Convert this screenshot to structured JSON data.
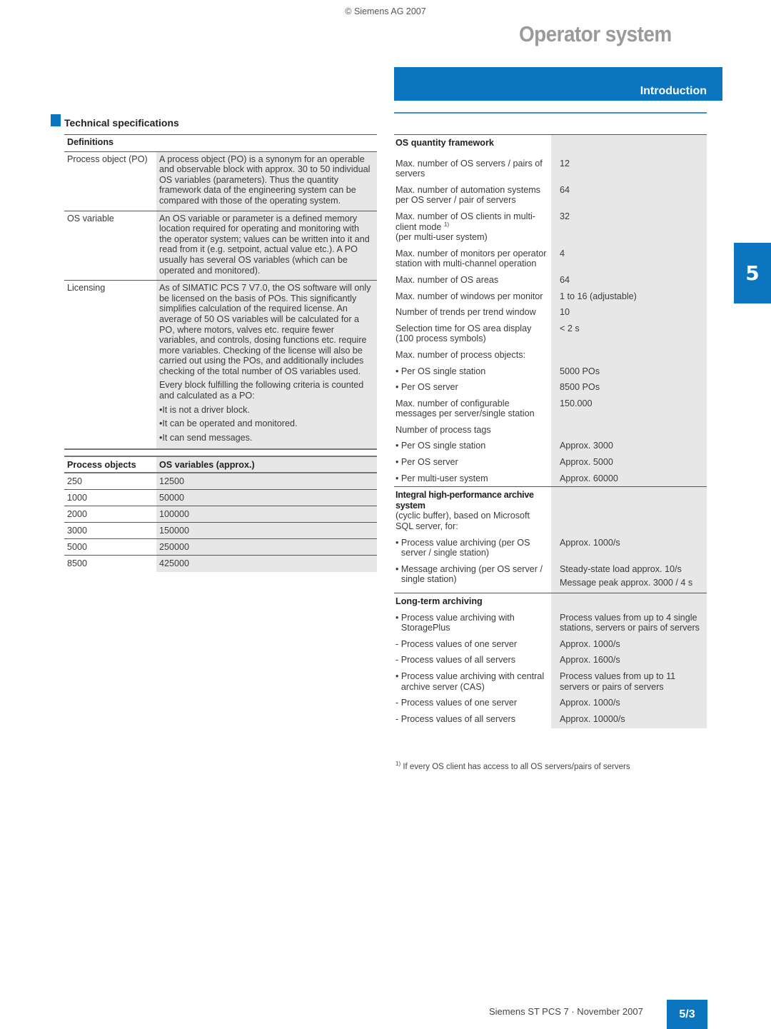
{
  "header": {
    "copyright": "© Siemens AG 2007",
    "page_title": "Operator system",
    "section": "Introduction",
    "chapter_tab": "5"
  },
  "spec_heading": "Technical specifications",
  "definitions": {
    "heading": "Definitions",
    "items": [
      {
        "term": "Process object (PO)",
        "paragraphs": [
          "A process object (PO) is a synonym for an operable and observable block with approx. 30 to 50 individual OS variables (parameters). Thus the quantity framework data of the engineering system can be compared with those of the operating system."
        ],
        "bullets": []
      },
      {
        "term": "OS variable",
        "paragraphs": [
          "An OS variable or parameter is a defined memory location required for operating and monitoring with the operator system; values can be written into it and read from it (e.g. setpoint, actual value etc.). A PO usually has several OS variables (which can be operated and monitored)."
        ],
        "bullets": []
      },
      {
        "term": "Licensing",
        "paragraphs": [
          "As of SIMATIC PCS 7 V7.0, the OS software will only be licensed on the basis of POs. This significantly simplifies calculation of the required license. An average of 50 OS variables will be calculated for a PO, where motors, valves etc. require fewer variables, and controls, dosing functions etc. require more variables. Checking of the license will also be carried out using the POs, and additionally includes checking of the total number of OS variables used.",
          "Every block fulfilling the following criteria is counted and calculated as a PO:"
        ],
        "bullets": [
          "It is not a driver block.",
          "It can be operated and monitored.",
          "It can send messages."
        ]
      }
    ]
  },
  "po_table": {
    "headers": [
      "Process objects",
      "OS variables (approx.)"
    ],
    "rows": [
      [
        "250",
        "12500"
      ],
      [
        "1000",
        "50000"
      ],
      [
        "2000",
        "100000"
      ],
      [
        "3000",
        "150000"
      ],
      [
        "5000",
        "250000"
      ],
      [
        "8500",
        "425000"
      ]
    ]
  },
  "quantity_framework": {
    "heading": "OS quantity framework",
    "rows": [
      {
        "label": "Max. number of OS servers / pairs of servers",
        "value": "12"
      },
      {
        "label": "Max. number of automation systems per OS server / pair of servers",
        "value": "64"
      },
      {
        "label": "Max. number of OS clients in multi-client mode",
        "footnote_ref": "1)",
        "label_suffix": "(per multi-user system)",
        "value": "32"
      },
      {
        "label": "Max. number of monitors per operator station with multi-channel operation",
        "value": "4"
      },
      {
        "label": "Max. number of OS areas",
        "value": "64"
      },
      {
        "label": "Max. number of windows per monitor",
        "value": "1 to 16 (adjustable)"
      },
      {
        "label": "Number of trends per trend window",
        "value": "10"
      },
      {
        "label": "Selection time for OS area display (100 process symbols)",
        "value": "< 2 s"
      },
      {
        "label": "Max. number of process objects:",
        "value": ""
      },
      {
        "label": "• Per OS single station",
        "value": "5000 POs"
      },
      {
        "label": "• Per OS server",
        "value": "8500 POs"
      },
      {
        "label": "Max. number of configurable messages per server/single station",
        "value": "150.000"
      },
      {
        "label": "Number of process tags",
        "value": ""
      },
      {
        "label": "• Per OS single station",
        "value": "Approx. 3000"
      },
      {
        "label": "• Per OS server",
        "value": "Approx. 5000"
      },
      {
        "label": "• Per multi-user system",
        "value": "Approx. 60000"
      }
    ]
  },
  "archive_system": {
    "heading": "Integral high-performance archive system",
    "description": "(cyclic buffer), based on Microsoft SQL server, for:",
    "rows": [
      {
        "label": "Process value archiving (per OS server / single station)",
        "values": [
          "Approx. 1000/s"
        ]
      },
      {
        "label": "Message archiving (per OS server / single station)",
        "values": [
          "Steady-state load approx. 10/s",
          "Message peak approx. 3000 / 4 s"
        ]
      }
    ]
  },
  "long_term_archiving": {
    "heading": "Long-term archiving",
    "rows": [
      {
        "type": "bullet",
        "label": "Process value archiving with StoragePlus",
        "value": "Process values from up to 4 single stations, servers or pairs of servers"
      },
      {
        "type": "dash",
        "label": "Process values of one server",
        "value": "Approx. 1000/s"
      },
      {
        "type": "dash",
        "label": "Process values of all servers",
        "value": "Approx. 1600/s"
      },
      {
        "type": "bullet",
        "label": "Process value archiving with central archive server (CAS)",
        "value": "Process values from up to 11 servers or pairs of servers"
      },
      {
        "type": "dash",
        "label": "Process values of one server",
        "value": "Approx. 1000/s"
      },
      {
        "type": "dash",
        "label": "Process values of all servers",
        "value": "Approx. 10000/s"
      }
    ]
  },
  "footnote": {
    "marker": "1)",
    "text": "If every OS client has access to all OS servers/pairs of servers"
  },
  "footer": {
    "text": "Siemens ST PCS 7 · November 2007",
    "page_number": "5/3"
  },
  "colors": {
    "brand_blue": "#0b76bf",
    "title_gray": "#9a9a9a",
    "cell_gray": "#e7e7e7"
  }
}
